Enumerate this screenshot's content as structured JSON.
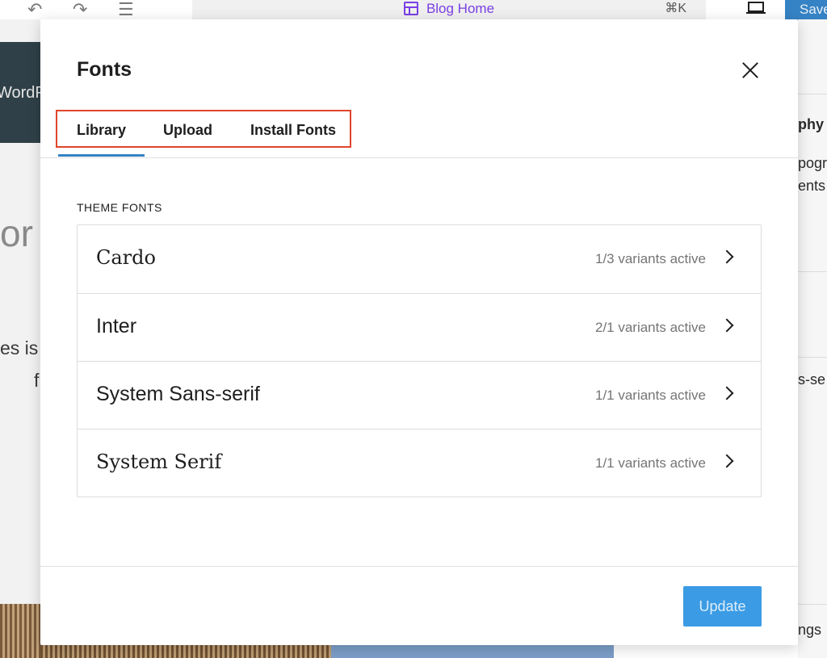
{
  "editor": {
    "document_title": "Blog Home",
    "shortcut": "⌘K",
    "save_label": "Save",
    "left_fragments": {
      "hero_text": "WordP",
      "heading_fragment": "or",
      "body_fragment_1": "es is",
      "body_fragment_2": "f"
    },
    "right_fragments": [
      "phy",
      "pogr",
      "ents",
      "s-se",
      "ngs"
    ]
  },
  "modal": {
    "title": "Fonts",
    "tabs": [
      {
        "label": "Library",
        "active": true
      },
      {
        "label": "Upload",
        "active": false
      },
      {
        "label": "Install Fonts",
        "active": false
      }
    ],
    "section_label": "THEME FONTS",
    "fonts": [
      {
        "name": "Cardo",
        "variants": "1/3 variants active",
        "style": "serif"
      },
      {
        "name": "Inter",
        "variants": "2/1 variants active",
        "style": "sans"
      },
      {
        "name": "System Sans-serif",
        "variants": "1/1 variants active",
        "style": "sans"
      },
      {
        "name": "System Serif",
        "variants": "1/1 variants active",
        "style": "serif"
      }
    ],
    "update_label": "Update"
  },
  "colors": {
    "accent": "#3582c4",
    "highlight_border": "#e0452b",
    "update_button": "#1a8ae0"
  }
}
